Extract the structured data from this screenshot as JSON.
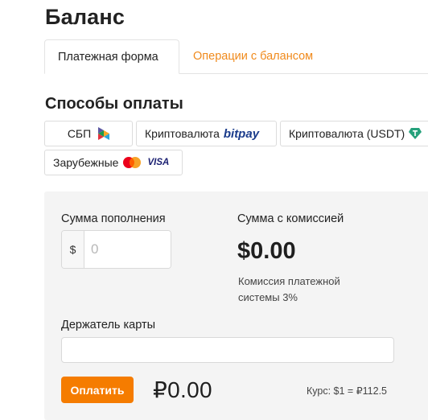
{
  "page": {
    "title": "Баланс"
  },
  "tabs": [
    {
      "label": "Платежная форма",
      "active": true
    },
    {
      "label": "Операции с балансом",
      "active": false
    }
  ],
  "payment_methods": {
    "title": "Способы оплаты",
    "items": [
      {
        "label": "СБП",
        "icon": "sbp-logo-icon"
      },
      {
        "label": "Криптовалюта",
        "logo_text": "bitpay",
        "icon": "bitpay-logo"
      },
      {
        "label": "Криптовалюта (USDT)",
        "icon": "tether-icon"
      },
      {
        "label": "Зарубежные",
        "icon": "mastercard-icon",
        "logo_text": "VISA"
      }
    ]
  },
  "form": {
    "amount_label": "Сумма пополнения",
    "currency_prefix": "$",
    "amount_placeholder": "0",
    "total_label": "Сумма с комиссией",
    "total_value": "$0.00",
    "fee_note": "Комиссия платежной системы 3%",
    "holder_label": "Держатель карты",
    "holder_value": "",
    "pay_button": "Оплатить",
    "rub_total": "₽0.00",
    "rate": "Курс: $1 = ₽112.5"
  },
  "colors": {
    "accent": "#f57c00",
    "tab_inactive_text": "#f08a1c",
    "panel_bg": "#f4f4f4",
    "bitpay": "#1a3b8b",
    "visa": "#1a1f71",
    "tether": "#26a17b"
  }
}
